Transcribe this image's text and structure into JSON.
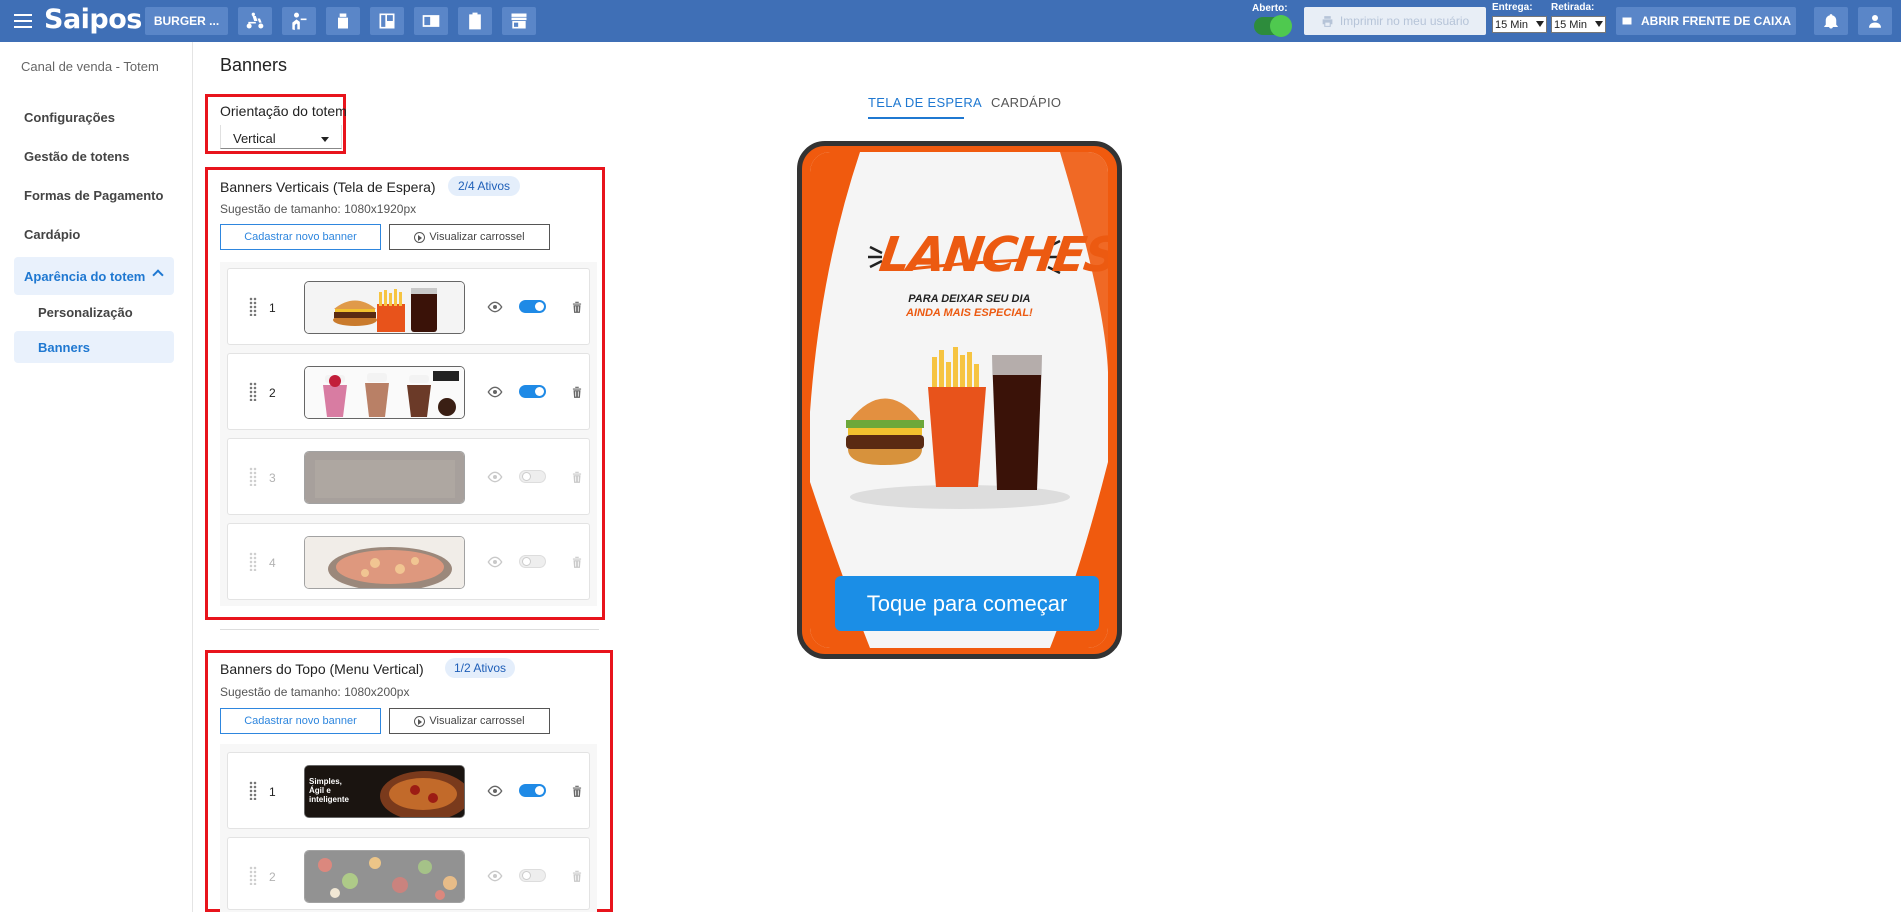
{
  "header": {
    "logo": "Saipos",
    "store_name": "BURGER ...",
    "open_label": "Aberto:",
    "print_label": "Imprimir no meu usuário",
    "delivery_label": "Entrega:",
    "delivery_value": "15 Min",
    "pickup_label": "Retirada:",
    "pickup_value": "15 Min",
    "cashier_label": "ABRIR FRENTE DE CAIXA"
  },
  "sidebar": {
    "title": "Canal de venda - Totem",
    "items": [
      "Configurações",
      "Gestão de totens",
      "Formas de Pagamento",
      "Cardápio"
    ],
    "active_group": "Aparência do totem",
    "sub_items": [
      "Personalização",
      "Banners"
    ]
  },
  "main": {
    "title": "Banners",
    "orientation_label": "Orientação do totem",
    "orientation_value": "Vertical",
    "vertical_section": {
      "title": "Banners Verticais (Tela de Espera)",
      "badge": "2/4 Ativos",
      "hint": "Sugestão de tamanho: 1080x1920px",
      "add_button": "Cadastrar novo banner",
      "preview_button": "Visualizar carrossel",
      "rows": [
        {
          "num": "1",
          "active": true
        },
        {
          "num": "2",
          "active": true
        },
        {
          "num": "3",
          "active": false
        },
        {
          "num": "4",
          "active": false
        }
      ]
    },
    "top_section": {
      "title": "Banners do Topo (Menu Vertical)",
      "badge": "1/2 Ativos",
      "hint": "Sugestão de tamanho: 1080x200px",
      "add_button": "Cadastrar novo banner",
      "preview_button": "Visualizar carrossel",
      "rows": [
        {
          "num": "1",
          "active": true,
          "thumb_text": "Simples, Ágil e inteligente"
        },
        {
          "num": "2",
          "active": false
        }
      ]
    }
  },
  "preview": {
    "tabs": [
      "TELA DE ESPERA",
      "CARDÁPIO"
    ],
    "active_tab": "TELA DE ESPERA",
    "headline": "LANCHES",
    "tagline_1": "PARA DEIXAR SEU DIA",
    "tagline_2": "AINDA MAIS ESPECIAL!",
    "cta": "Toque para começar"
  },
  "colors": {
    "header_bg": "#3f6fb6",
    "accent": "#1f78d1",
    "highlight_border": "#e8141c",
    "brand_orange": "#f05a0e"
  }
}
